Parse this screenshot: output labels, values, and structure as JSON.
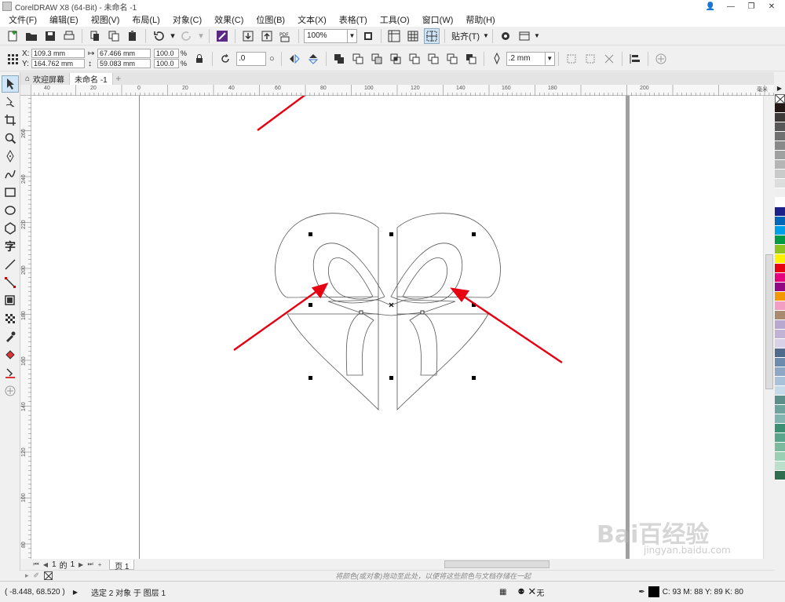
{
  "window": {
    "title": "CorelDRAW X8 (64-Bit) - 未命名 -1"
  },
  "menu": [
    "文件(F)",
    "编辑(E)",
    "视图(V)",
    "布局(L)",
    "对象(C)",
    "效果(C)",
    "位图(B)",
    "文本(X)",
    "表格(T)",
    "工具(O)",
    "窗口(W)",
    "帮助(H)"
  ],
  "toolbar": {
    "zoom": "100%",
    "snap_label": "贴齐(T)"
  },
  "properties": {
    "x": "109.3 mm",
    "y": "164.762 mm",
    "width": "67.466 mm",
    "height": "59.083 mm",
    "scale_w": "100.0",
    "scale_h": "100.0",
    "pct": "%",
    "rotation": ".0",
    "outline_width": ".2 mm"
  },
  "tabs": [
    {
      "label": "欢迎屏幕"
    },
    {
      "label": "未命名 -1"
    }
  ],
  "ruler": {
    "h_labels": [
      "40",
      "20",
      "0",
      "20",
      "40",
      "60",
      "80",
      "100",
      "120",
      "140",
      "160",
      "180",
      "200"
    ],
    "unit": "毫米",
    "v_labels": [
      "260",
      "240",
      "220",
      "200",
      "180",
      "160",
      "140",
      "120",
      "100",
      "80",
      "60",
      "40"
    ]
  },
  "pagenav": {
    "current": "1",
    "of": "的",
    "total": "1",
    "page_tab": "页 1"
  },
  "dropbar": {
    "hint": "将颜色(或对象)拖动至此处，以便将这些颜色与文档存储在一起"
  },
  "status": {
    "coords": "( -8.448, 68.520 )",
    "selection": "选定 2 对象 于 图层 1",
    "fill": "无",
    "color_value": "C: 93 M: 88 Y: 89 K: 80"
  },
  "palette_colors": [
    "#231815",
    "#3e3a39",
    "#595757",
    "#727171",
    "#898989",
    "#9fa0a0",
    "#b5b5b6",
    "#c9caca",
    "#dcdddd",
    "#efefef",
    "#ffffff",
    "#1d2088",
    "#0068b7",
    "#00a0e9",
    "#009944",
    "#8fc31f",
    "#fff100",
    "#e60012",
    "#e4007f",
    "#920783",
    "#f39800",
    "#f19ec2",
    "#a98a6f",
    "#b8a8d0",
    "#c0b3d4",
    "#d8d0e6",
    "#4e6b8c",
    "#6d8bad",
    "#8da7c4",
    "#a8c2da",
    "#c6dae9",
    "#5c8f8a",
    "#6ea39e",
    "#82b5b0",
    "#3d8f73",
    "#58a58b",
    "#7cba9f",
    "#9acfb4",
    "#bcdfcb",
    "#2f6f4f"
  ],
  "watermark": {
    "brand": "Bai百经验",
    "url": "jingyan.baidu.com"
  },
  "accent": "#e60012"
}
